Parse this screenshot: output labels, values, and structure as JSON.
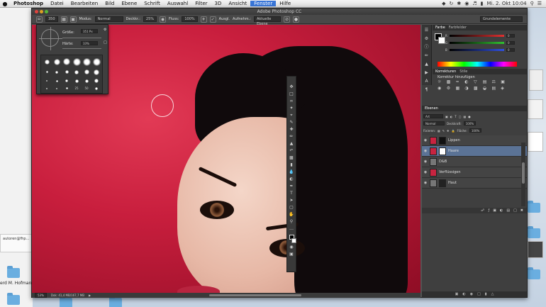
{
  "menubar": {
    "apple": "",
    "app": "Photoshop",
    "items": [
      "Datei",
      "Bearbeiten",
      "Bild",
      "Ebene",
      "Schrift",
      "Auswahl",
      "Filter",
      "3D",
      "Ansicht",
      "Fenster",
      "Hilfe"
    ],
    "active_item": "Fenster",
    "clock": "Mi. 2. Okt 10:04"
  },
  "window": {
    "title": "Adobe Photoshop CC"
  },
  "options": {
    "modus_label": "Modus:",
    "modus_value": "Normal",
    "deckkraft_label": "Deckkr.:",
    "deckkraft_value": "25%",
    "fluss_label": "Fluss:",
    "fluss_value": "100%",
    "ausgl_label": "Ausgl.",
    "aufnehmen_label": "Aufnehm.:",
    "aufnehmen_value": "Aktuelle Ebene",
    "workspace": "Grundelemente",
    "brush_size": "350"
  },
  "brush_popup": {
    "groesse_label": "Größe:",
    "groesse_value": "351 Px",
    "haerte_label": "Härte:",
    "haerte_value": "33%",
    "tip_numbers": [
      "25",
      "50"
    ]
  },
  "status": {
    "zoom": "53%",
    "doc": "Dok: 41,4 MB/167,7 MB"
  },
  "color_panel": {
    "tabs": [
      "Farbe",
      "Farbfelder"
    ],
    "rows": [
      {
        "label": "R",
        "value": "0",
        "color": "#e03030"
      },
      {
        "label": "G",
        "value": "0",
        "color": "#30c030"
      },
      {
        "label": "B",
        "value": "0",
        "color": "#3050e0"
      }
    ]
  },
  "adjust_panel": {
    "tabs": [
      "Korrekturen",
      "Stile"
    ],
    "subtitle": "Korrektur hinzufügen"
  },
  "layers_panel": {
    "title": "Ebenen",
    "filter_label": "Art",
    "blend": "Normal",
    "opacity_label": "Deckkraft:",
    "opacity_value": "100%",
    "fixieren_label": "Fixieren:",
    "flaeche_label": "Fläche:",
    "flaeche_value": "100%",
    "layers": [
      {
        "name": "Lippen",
        "selected": false
      },
      {
        "name": "Haare",
        "selected": true
      },
      {
        "name": "D&B",
        "selected": false
      },
      {
        "name": "Verflüssigen",
        "selected": false
      },
      {
        "name": "Haut",
        "selected": false
      }
    ]
  },
  "desktop": {
    "file_name": "autoren@fhp...",
    "user": "erd M. Hofmann"
  },
  "colors": {
    "canvas_bg": "#c81e3d",
    "selected_layer": "#5b7396"
  }
}
